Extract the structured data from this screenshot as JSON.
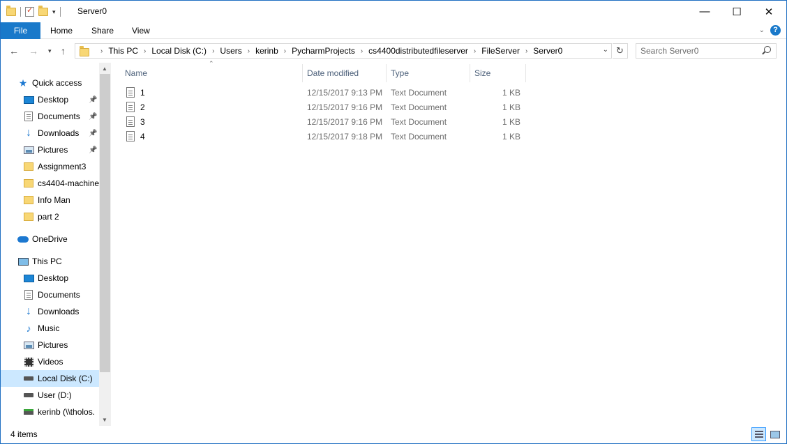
{
  "window": {
    "title": "Server0",
    "controls": {
      "minimize": "—",
      "maximize": "☐",
      "close": "✕"
    }
  },
  "ribbon": {
    "tabs": [
      "File",
      "Home",
      "Share",
      "View"
    ],
    "help": "?"
  },
  "address": {
    "crumbs": [
      "This PC",
      "Local Disk (C:)",
      "Users",
      "kerinb",
      "PycharmProjects",
      "cs4400distributedfileserver",
      "FileServer",
      "Server0"
    ],
    "search_placeholder": "Search Server0"
  },
  "nav": {
    "items": [
      {
        "label": "Quick access",
        "icon": "star-icon"
      },
      {
        "label": "Desktop",
        "icon": "desktop-icon",
        "pinned": true
      },
      {
        "label": "Documents",
        "icon": "documents-icon",
        "pinned": true
      },
      {
        "label": "Downloads",
        "icon": "downloads-icon",
        "pinned": true
      },
      {
        "label": "Pictures",
        "icon": "pictures-icon",
        "pinned": true
      },
      {
        "label": "Assignment3",
        "icon": "folder-icon"
      },
      {
        "label": "cs4404-machine",
        "icon": "folder-icon"
      },
      {
        "label": "Info Man",
        "icon": "folder-icon"
      },
      {
        "label": "part 2",
        "icon": "folder-icon"
      },
      {
        "label": "OneDrive",
        "icon": "cloud-icon"
      },
      {
        "label": "This PC",
        "icon": "computer-icon"
      },
      {
        "label": "Desktop",
        "icon": "desktop-icon"
      },
      {
        "label": "Documents",
        "icon": "documents-icon"
      },
      {
        "label": "Downloads",
        "icon": "downloads-icon"
      },
      {
        "label": "Music",
        "icon": "music-icon"
      },
      {
        "label": "Pictures",
        "icon": "pictures-icon"
      },
      {
        "label": "Videos",
        "icon": "videos-icon"
      },
      {
        "label": "Local Disk (C:)",
        "icon": "drive-icon",
        "selected": true
      },
      {
        "label": "User (D:)",
        "icon": "drive-icon"
      },
      {
        "label": "kerinb (\\\\tholos.",
        "icon": "network-drive-icon"
      }
    ]
  },
  "columns": {
    "name": "Name",
    "date": "Date modified",
    "type": "Type",
    "size": "Size"
  },
  "files": [
    {
      "name": "1",
      "date": "12/15/2017 9:13 PM",
      "type": "Text Document",
      "size": "1 KB"
    },
    {
      "name": "2",
      "date": "12/15/2017 9:16 PM",
      "type": "Text Document",
      "size": "1 KB"
    },
    {
      "name": "3",
      "date": "12/15/2017 9:16 PM",
      "type": "Text Document",
      "size": "1 KB"
    },
    {
      "name": "4",
      "date": "12/15/2017 9:18 PM",
      "type": "Text Document",
      "size": "1 KB"
    }
  ],
  "status": {
    "item_count": "4 items"
  }
}
